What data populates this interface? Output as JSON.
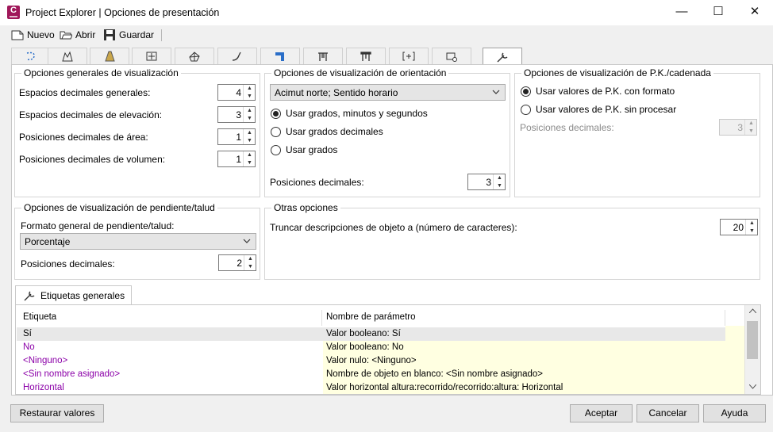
{
  "window": {
    "app_icon_letter": "C",
    "title": "Project Explorer | Opciones de presentación",
    "minimize": "—",
    "maximize": "☐",
    "close": "✕"
  },
  "toolbar": {
    "new_label": "Nuevo",
    "open_label": "Abrir",
    "save_label": "Guardar"
  },
  "icon_tabs": [
    "points-icon",
    "profile-views-icon",
    "road-icon",
    "alignment-icon",
    "surface-icon",
    "curve-icon",
    "corridor-icon",
    "structure-icon",
    "pipe-icon",
    "section-icon",
    "parcel-icon",
    "settings-icon"
  ],
  "general": {
    "title": "Opciones generales de visualización",
    "rows": [
      {
        "label": "Espacios decimales generales:",
        "value": "4"
      },
      {
        "label": "Espacios decimales de elevación:",
        "value": "3"
      },
      {
        "label": "Posiciones decimales de área:",
        "value": "1"
      },
      {
        "label": "Posiciones decimales de volumen:",
        "value": "1"
      }
    ]
  },
  "orientation": {
    "title": "Opciones de visualización de orientación",
    "combo_value": "Acimut norte; Sentido horario",
    "radios": [
      {
        "label": "Usar grados, minutos y segundos",
        "checked": true
      },
      {
        "label": "Usar grados decimales",
        "checked": false
      },
      {
        "label": "Usar grados",
        "checked": false
      }
    ],
    "decimals_label": "Posiciones decimales:",
    "decimals_value": "3"
  },
  "station": {
    "title": "Opciones de visualización de P.K./cadenada",
    "radios": [
      {
        "label": "Usar valores de P.K. con formato",
        "checked": true
      },
      {
        "label": "Usar valores de P.K. sin procesar",
        "checked": false
      }
    ],
    "decimals_label": "Posiciones decimales:",
    "decimals_value": "3"
  },
  "slope": {
    "title": "Opciones de visualización de pendiente/talud",
    "format_label": "Formato general de pendiente/talud:",
    "format_value": "Porcentaje",
    "decimals_label": "Posiciones decimales:",
    "decimals_value": "2"
  },
  "other": {
    "title": "Otras opciones",
    "truncate_label": "Truncar descripciones de objeto a (número de caracteres):",
    "truncate_value": "20"
  },
  "labels_tab": {
    "label": "Etiquetas generales",
    "columns": [
      "Etiqueta",
      "Nombre de parámetro"
    ],
    "rows": [
      {
        "label": "Sí",
        "param": "Valor booleano: Sí"
      },
      {
        "label": "No",
        "param": "Valor booleano: No"
      },
      {
        "label": "<Ninguno>",
        "param": "Valor nulo: <Ninguno>"
      },
      {
        "label": "<Sin nombre asignado>",
        "param": "Nombre de objeto en blanco: <Sin nombre asignado>"
      },
      {
        "label": "Horizontal",
        "param": "Valor horizontal altura:recorrido/recorrido:altura: Horizontal"
      }
    ]
  },
  "buttons": {
    "restore": "Restaurar valores",
    "accept": "Aceptar",
    "cancel": "Cancelar",
    "help": "Ayuda"
  },
  "colors": {
    "accent_purple": "#8b00a8",
    "param_cell_bg": "#ffffe1",
    "app_icon": "#a0185a"
  }
}
